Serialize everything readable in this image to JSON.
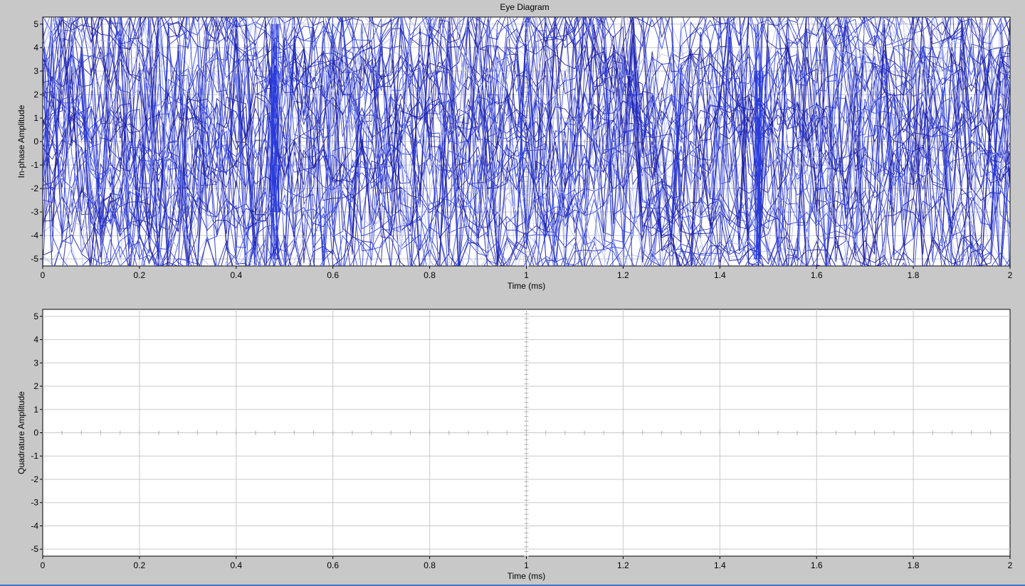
{
  "window": {
    "title": "Eye Diagram"
  },
  "colors": {
    "figure_background": "#c8c8c8",
    "plot_background": "#ffffff",
    "grid": "#c8c8c8",
    "trace_dark": "#1a1a9c",
    "trace_mid": "#2b3ddc",
    "trace_light": "#b4bcf0",
    "center_tick": "#b0b0b0"
  },
  "chart_data": [
    {
      "type": "line",
      "title": "Eye Diagram",
      "xlabel": "Time (ms)",
      "ylabel": "In-phase Amplitude",
      "xlim": [
        0,
        2
      ],
      "ylim": [
        -5.3,
        5.3
      ],
      "x_ticks": [
        0,
        0.2,
        0.4,
        0.6,
        0.8,
        1,
        1.2,
        1.4,
        1.6,
        1.8,
        2
      ],
      "x_tick_labels": [
        "0",
        "0.2",
        "0.4",
        "0.6",
        "0.8",
        "1",
        "1.2",
        "1.4",
        "1.6",
        "1.8",
        "2"
      ],
      "y_ticks": [
        -5,
        -4,
        -3,
        -2,
        -1,
        0,
        1,
        2,
        3,
        4,
        5
      ],
      "y_tick_labels": [
        "-5",
        "-4",
        "-3",
        "-2",
        "-1",
        "0",
        "1",
        "2",
        "3",
        "4",
        "5"
      ],
      "grid": true,
      "legend": "none",
      "description_of_traces": "dense overlapping noisy traces, 16-level style amplitudes (about ±1, ±3, ±5) with transition bursts near 0.48 ms and 1.48 ms",
      "trace_levels": [
        -5,
        -3,
        -1,
        1,
        3,
        5
      ],
      "trace_count": 60,
      "dense_columns_ms": [
        0.48,
        1.48
      ]
    },
    {
      "type": "line",
      "title": "",
      "xlabel": "Time (ms)",
      "ylabel": "Quadrature Amplitude",
      "xlim": [
        0,
        2
      ],
      "ylim": [
        -5.3,
        5.3
      ],
      "x_ticks": [
        0,
        0.2,
        0.4,
        0.6,
        0.8,
        1,
        1.2,
        1.4,
        1.6,
        1.8,
        2
      ],
      "x_tick_labels": [
        "0",
        "0.2",
        "0.4",
        "0.6",
        "0.8",
        "1",
        "1.2",
        "1.4",
        "1.6",
        "1.8",
        "2"
      ],
      "y_ticks": [
        -5,
        -4,
        -3,
        -2,
        -1,
        0,
        1,
        2,
        3,
        4,
        5
      ],
      "y_tick_labels": [
        "-5",
        "-4",
        "-3",
        "-2",
        "-1",
        "0",
        "1",
        "2",
        "3",
        "4",
        "5"
      ],
      "grid": true,
      "legend": "none",
      "series": []
    }
  ]
}
